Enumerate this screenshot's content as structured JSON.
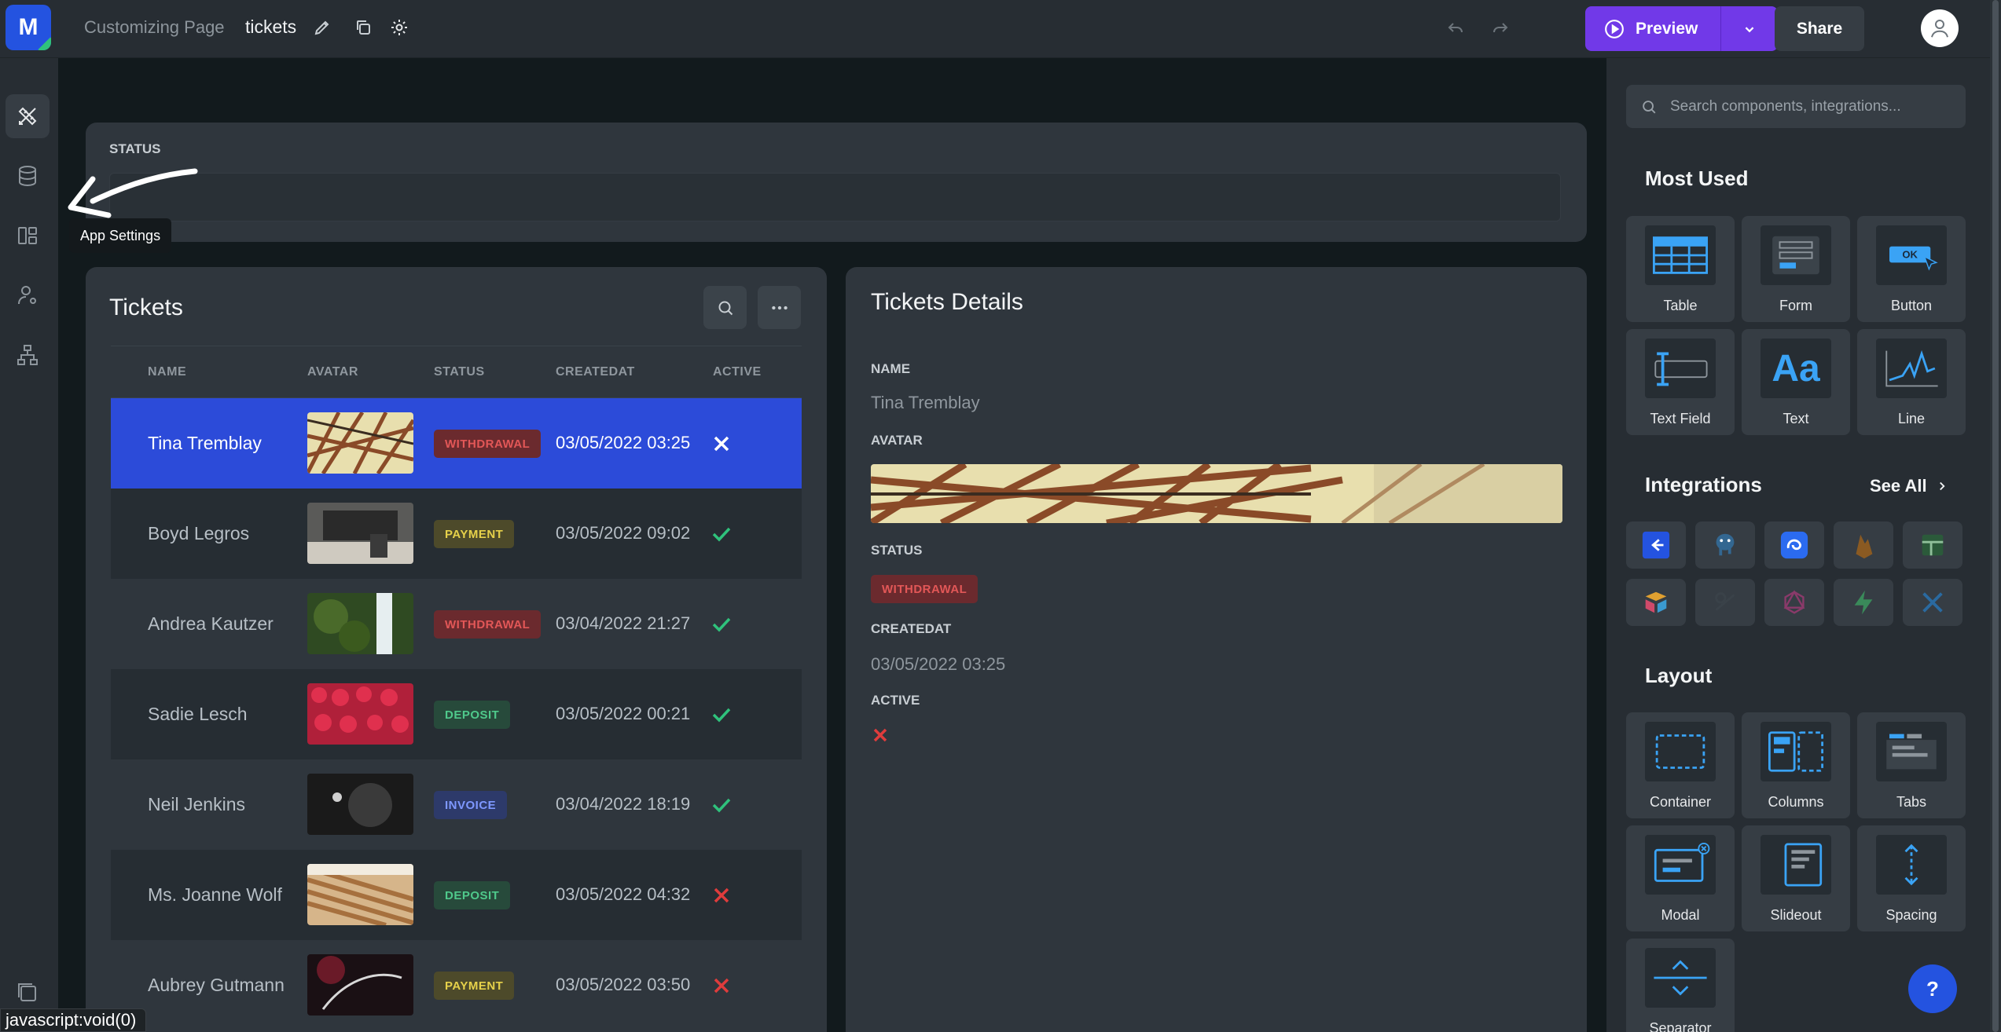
{
  "topbar": {
    "logo_letter": "M",
    "crumb": "Customizing Page",
    "page_name": "tickets",
    "preview_label": "Preview",
    "share_label": "Share"
  },
  "leftnav": {
    "tooltip": "App Settings"
  },
  "status_filter": {
    "label": "STATUS",
    "value": ""
  },
  "tickets": {
    "title": "Tickets",
    "columns": [
      "NAME",
      "AVATAR",
      "STATUS",
      "CREATEDAT",
      "ACTIVE"
    ],
    "rows": [
      {
        "name": "Tina Tremblay",
        "status": "WITHDRAWAL",
        "date": "03/05/2022 03:25",
        "active": false,
        "selected": true
      },
      {
        "name": "Boyd Legros",
        "status": "PAYMENT",
        "date": "03/05/2022 09:02",
        "active": true
      },
      {
        "name": "Andrea Kautzer",
        "status": "WITHDRAWAL",
        "date": "03/04/2022 21:27",
        "active": true
      },
      {
        "name": "Sadie Lesch",
        "status": "DEPOSIT",
        "date": "03/05/2022 00:21",
        "active": true
      },
      {
        "name": "Neil Jenkins",
        "status": "INVOICE",
        "date": "03/04/2022 18:19",
        "active": true
      },
      {
        "name": "Ms. Joanne Wolf",
        "status": "DEPOSIT",
        "date": "03/05/2022 04:32",
        "active": false
      },
      {
        "name": "Aubrey Gutmann",
        "status": "PAYMENT",
        "date": "03/05/2022 03:50",
        "active": false
      }
    ]
  },
  "details": {
    "title": "Tickets Details",
    "name_label": "NAME",
    "name_value": "Tina Tremblay",
    "avatar_label": "AVATAR",
    "status_label": "STATUS",
    "status_value": "WITHDRAWAL",
    "createdat_label": "CREATEDAT",
    "createdat_value": "03/05/2022 03:25",
    "active_label": "ACTIVE",
    "active_value": false
  },
  "panel": {
    "search_placeholder": "Search components, integrations...",
    "most_used_title": "Most Used",
    "most_used": [
      "Table",
      "Form",
      "Button",
      "Text Field",
      "Text",
      "Line"
    ],
    "button_preview_text": "OK",
    "text_preview_text": "Aa",
    "integrations_title": "Integrations",
    "see_all": "See All",
    "layout_title": "Layout",
    "layout": [
      "Container",
      "Columns",
      "Tabs",
      "Modal",
      "Slideout",
      "Spacing",
      "Separator"
    ]
  },
  "help_label": "?",
  "status_url": "javascript:void(0)",
  "colors": {
    "accent": "#7139e8",
    "selected_row": "#2c4bd9",
    "brand": "#2453e0",
    "success": "#2fc27c",
    "danger": "#e03c3c"
  }
}
